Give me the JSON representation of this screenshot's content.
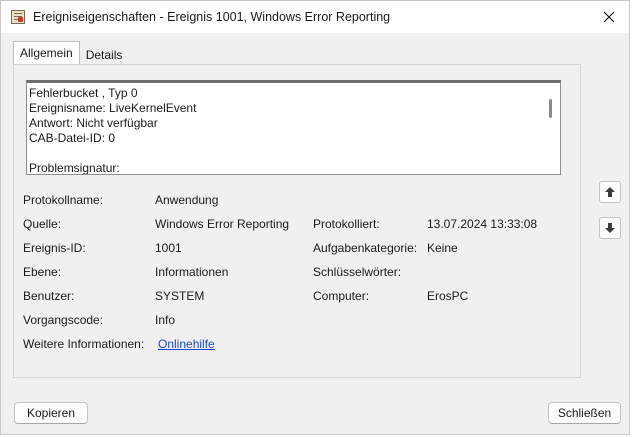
{
  "window": {
    "title": "Ereigniseigenschaften - Ereignis 1001, Windows Error Reporting"
  },
  "tabs": [
    {
      "label": "Allgemein",
      "active": true
    },
    {
      "label": "Details",
      "active": false
    }
  ],
  "description_lines": [
    "Fehlerbucket , Typ 0",
    "Ereignisname: LiveKernelEvent",
    "Antwort: Nicht verfügbar",
    "CAB-Datei-ID: 0",
    "",
    "Problemsignatur:"
  ],
  "fields": {
    "log_name": {
      "label": "Protokollname:",
      "value": "Anwendung"
    },
    "source": {
      "label": "Quelle:",
      "value": "Windows Error Reporting"
    },
    "logged": {
      "label": "Protokolliert:",
      "value": "13.07.2024 13:33:08"
    },
    "event_id": {
      "label": "Ereignis-ID:",
      "value": "1001"
    },
    "task_category": {
      "label": "Aufgabenkategorie:",
      "value": "Keine"
    },
    "level": {
      "label": "Ebene:",
      "value": "Informationen"
    },
    "keywords": {
      "label": "Schlüsselwörter:",
      "value": ""
    },
    "user": {
      "label": "Benutzer:",
      "value": "SYSTEM"
    },
    "computer": {
      "label": "Computer:",
      "value": "ErosPC"
    },
    "opcode": {
      "label": "Vorgangscode:",
      "value": "Info"
    },
    "more_info": {
      "label": "Weitere Informationen:",
      "link": "Onlinehilfe"
    }
  },
  "buttons": {
    "copy": "Kopieren",
    "close": "Schließen"
  },
  "icons": {
    "app": "event-viewer-icon",
    "close": "close-icon",
    "up": "arrow-up-icon",
    "down": "arrow-down-icon"
  },
  "colors": {
    "link": "#1a4bcc",
    "dialog_bg": "#f0f0f0"
  }
}
